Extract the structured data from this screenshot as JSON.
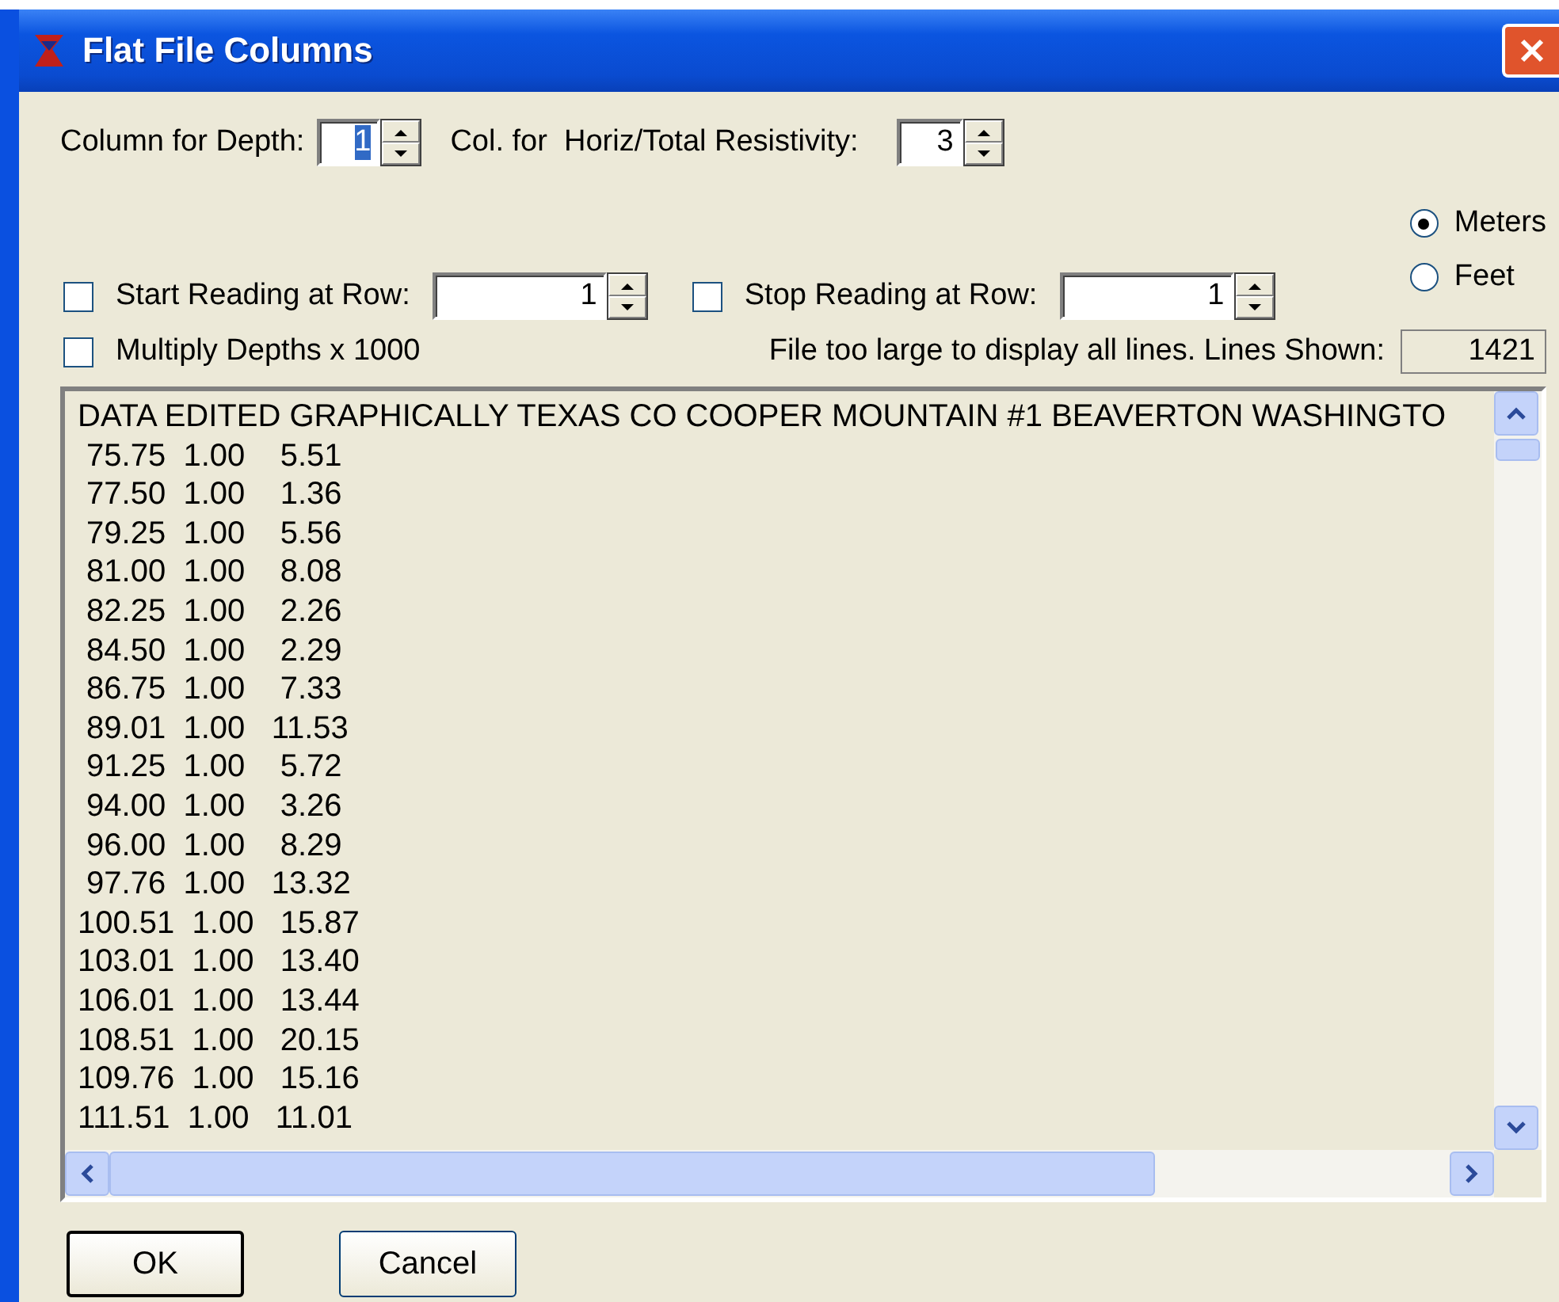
{
  "window": {
    "title": "Flat File Columns"
  },
  "depth_column": {
    "label": "Column for Depth:",
    "value": "1",
    "text_selected": true
  },
  "resistivity_column": {
    "label": "Col. for  Horiz/Total Resistivity:",
    "value": "3",
    "text_selected": false
  },
  "units": [
    {
      "label": "Meters",
      "selected": true
    },
    {
      "label": "Feet",
      "selected": false
    }
  ],
  "start_row": {
    "label": "Start Reading at Row:",
    "checked": false,
    "value": "1"
  },
  "stop_row": {
    "label": "Stop Reading at Row:",
    "checked": false,
    "value": "1"
  },
  "multiply_depths": {
    "label": "Multiply Depths x 1000",
    "checked": false
  },
  "lines_shown": {
    "label": "File too large to display all lines. Lines Shown:",
    "value": "1421"
  },
  "file_lines": [
    "DATA EDITED GRAPHICALLY TEXAS CO COOPER MOUNTAIN #1 BEAVERTON WASHINGTO",
    " 75.75  1.00    5.51",
    " 77.50  1.00    1.36",
    " 79.25  1.00    5.56",
    " 81.00  1.00    8.08",
    " 82.25  1.00    2.26",
    " 84.50  1.00    2.29",
    " 86.75  1.00    7.33",
    " 89.01  1.00   11.53",
    " 91.25  1.00    5.72",
    " 94.00  1.00    3.26",
    " 96.00  1.00    8.29",
    " 97.76  1.00   13.32",
    "100.51  1.00   15.87",
    "103.01  1.00   13.40",
    "106.01  1.00   13.44",
    "108.51  1.00   20.15",
    "109.76  1.00   15.16",
    "111.51  1.00   11.01"
  ],
  "buttons": [
    {
      "label": "OK",
      "default": true
    },
    {
      "label": "Cancel",
      "default": false
    }
  ]
}
